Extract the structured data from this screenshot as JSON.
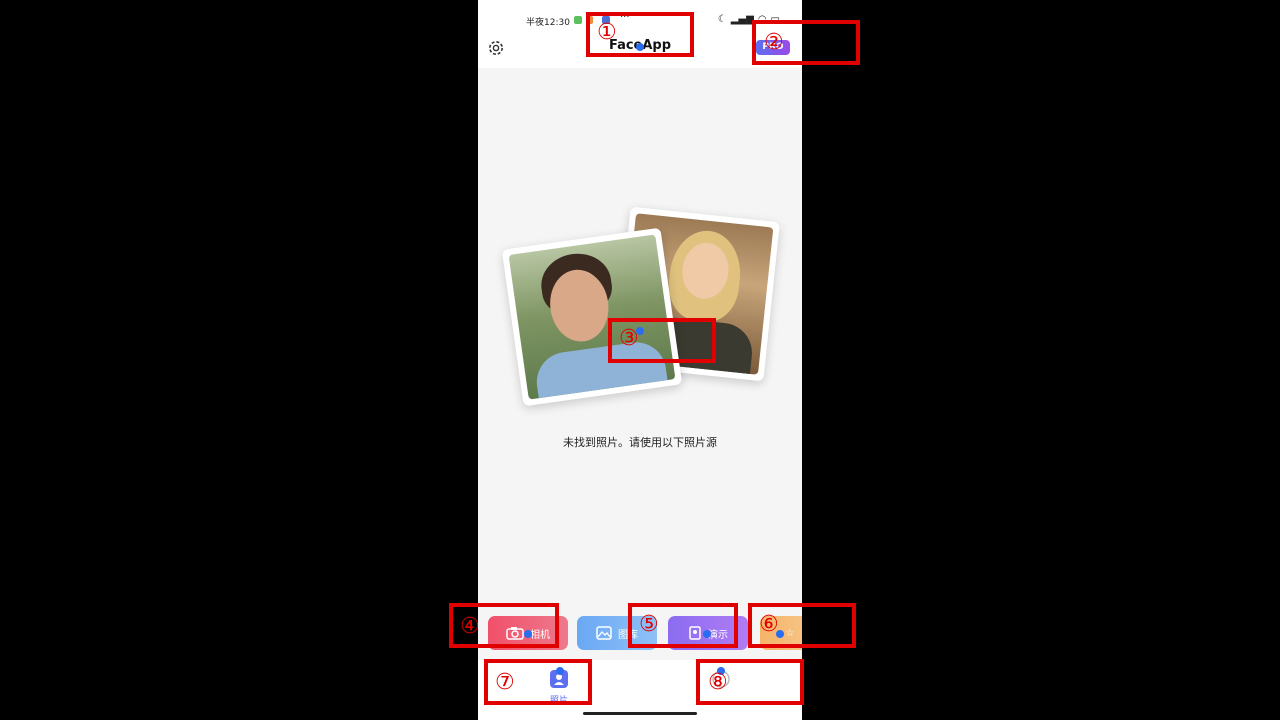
{
  "status_bar": {
    "time": "半夜12:30",
    "ellipsis": "···",
    "right_icons": [
      "moon-icon",
      "signal-icon",
      "wifi-icon",
      "battery-icon"
    ]
  },
  "header": {
    "title": "FaceApp",
    "pro_badge": "PRO",
    "settings_icon": "gear-icon"
  },
  "main": {
    "empty_message": "未找到照片。请使用以下照片源"
  },
  "sources": [
    {
      "label": "相机",
      "icon": "camera-icon"
    },
    {
      "label": "图库",
      "icon": "gallery-icon"
    },
    {
      "label": "演示",
      "icon": "demo-icon"
    },
    {
      "label": "",
      "icon": "star-icon"
    }
  ],
  "tabs": [
    {
      "label": "照片",
      "icon": "photos-icon",
      "active": true
    },
    {
      "label": "",
      "icon": "pro-tab-icon",
      "active": false
    }
  ],
  "annotations": [
    "①",
    "②",
    "③",
    "④",
    "⑤",
    "⑥",
    "⑦",
    "⑧"
  ],
  "colors": {
    "annotation": "#e00000",
    "accent": "#5b6ff0",
    "dot": "#2a6df0"
  }
}
